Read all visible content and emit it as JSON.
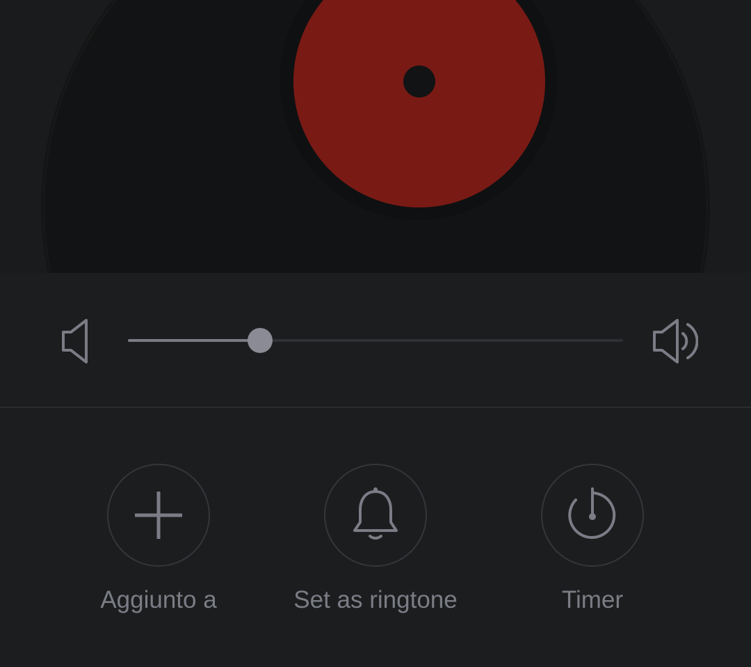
{
  "player": {
    "volume": {
      "level": 0.267
    },
    "actions": [
      {
        "id": "add",
        "label": "Aggiunto a",
        "icon": "plus-icon"
      },
      {
        "id": "ringtone",
        "label": "Set as ringtone",
        "icon": "bell-icon"
      },
      {
        "id": "timer",
        "label": "Timer",
        "icon": "timer-icon"
      }
    ]
  },
  "colors": {
    "background": "#1c1d1f",
    "vinyl": "#121314",
    "label": "#7a1a15",
    "icon": "#7b7c85"
  }
}
